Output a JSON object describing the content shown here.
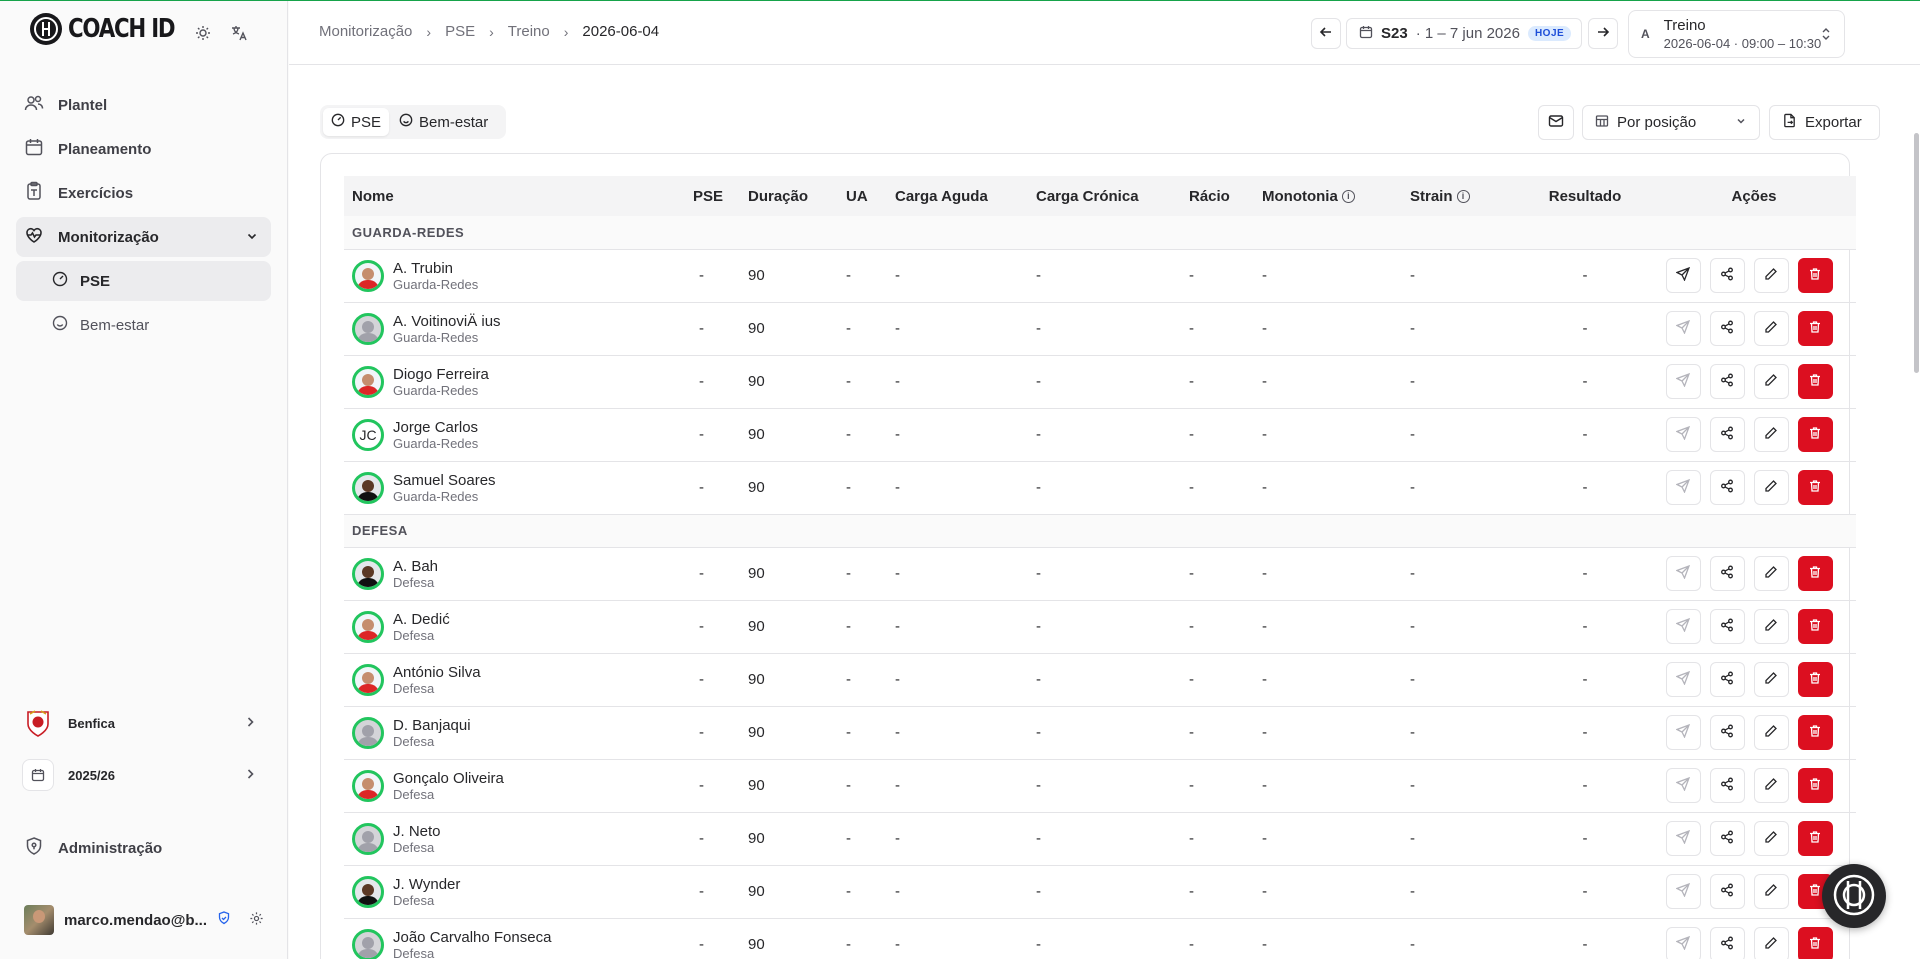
{
  "app": {
    "brand": "COACH ID"
  },
  "sidebar": {
    "items": [
      {
        "label": "Plantel"
      },
      {
        "label": "Planeamento"
      },
      {
        "label": "Exercícios"
      },
      {
        "label": "Monitorização"
      }
    ],
    "subitems": [
      {
        "label": "PSE"
      },
      {
        "label": "Bem-estar"
      }
    ],
    "club": "Benfica",
    "season": "2025/26",
    "admin": "Administração",
    "user_email": "marco.mendao@b..."
  },
  "topbar": {
    "breadcrumb": [
      "Monitorização",
      "PSE",
      "Treino",
      "2026-06-04"
    ],
    "week_code": "S23",
    "week_range": "· 1 – 7 jun 2026",
    "today_badge": "HOJE",
    "session_avatar": "A",
    "session_title": "Treino",
    "session_detail": "2026-06-04 · 09:00 – 10:30"
  },
  "toolbar": {
    "tabs": [
      {
        "label": "PSE"
      },
      {
        "label": "Bem-estar"
      }
    ],
    "group_select": "Por posição",
    "export_label": "Exportar"
  },
  "table": {
    "columns": [
      "Nome",
      "PSE",
      "Duração",
      "UA",
      "Carga Aguda",
      "Carga Crónica",
      "Rácio",
      "Monotonia",
      "Strain",
      "Resultado",
      "Ações"
    ],
    "groups": [
      {
        "name": "GUARDA-REDES",
        "players": [
          {
            "name": "A. Trubin",
            "position": "Guarda-Redes",
            "avatar": "photo",
            "initials": "",
            "send_enabled": true,
            "pse": "-",
            "duration": "90",
            "ua": "-",
            "acute": "-",
            "chronic": "-",
            "ratio": "-",
            "monotony": "-",
            "strain": "-",
            "result": "-"
          },
          {
            "name": "A. VoitinoviÄ ius",
            "position": "Guarda-Redes",
            "avatar": "grey",
            "initials": "",
            "send_enabled": false,
            "pse": "-",
            "duration": "90",
            "ua": "-",
            "acute": "-",
            "chronic": "-",
            "ratio": "-",
            "monotony": "-",
            "strain": "-",
            "result": "-"
          },
          {
            "name": "Diogo Ferreira",
            "position": "Guarda-Redes",
            "avatar": "photo",
            "initials": "",
            "send_enabled": false,
            "pse": "-",
            "duration": "90",
            "ua": "-",
            "acute": "-",
            "chronic": "-",
            "ratio": "-",
            "monotony": "-",
            "strain": "-",
            "result": "-"
          },
          {
            "name": "Jorge Carlos",
            "position": "Guarda-Redes",
            "avatar": "initials",
            "initials": "JC",
            "send_enabled": false,
            "pse": "-",
            "duration": "90",
            "ua": "-",
            "acute": "-",
            "chronic": "-",
            "ratio": "-",
            "monotony": "-",
            "strain": "-",
            "result": "-"
          },
          {
            "name": "Samuel Soares",
            "position": "Guarda-Redes",
            "avatar": "dark",
            "initials": "",
            "send_enabled": false,
            "pse": "-",
            "duration": "90",
            "ua": "-",
            "acute": "-",
            "chronic": "-",
            "ratio": "-",
            "monotony": "-",
            "strain": "-",
            "result": "-"
          }
        ]
      },
      {
        "name": "DEFESA",
        "players": [
          {
            "name": "A. Bah",
            "position": "Defesa",
            "avatar": "dark",
            "initials": "",
            "send_enabled": false,
            "pse": "-",
            "duration": "90",
            "ua": "-",
            "acute": "-",
            "chronic": "-",
            "ratio": "-",
            "monotony": "-",
            "strain": "-",
            "result": "-"
          },
          {
            "name": "A. Dedić",
            "position": "Defesa",
            "avatar": "photo",
            "initials": "",
            "send_enabled": false,
            "pse": "-",
            "duration": "90",
            "ua": "-",
            "acute": "-",
            "chronic": "-",
            "ratio": "-",
            "monotony": "-",
            "strain": "-",
            "result": "-"
          },
          {
            "name": "António Silva",
            "position": "Defesa",
            "avatar": "photo",
            "initials": "",
            "send_enabled": false,
            "pse": "-",
            "duration": "90",
            "ua": "-",
            "acute": "-",
            "chronic": "-",
            "ratio": "-",
            "monotony": "-",
            "strain": "-",
            "result": "-"
          },
          {
            "name": "D. Banjaqui",
            "position": "Defesa",
            "avatar": "grey",
            "initials": "",
            "send_enabled": false,
            "pse": "-",
            "duration": "90",
            "ua": "-",
            "acute": "-",
            "chronic": "-",
            "ratio": "-",
            "monotony": "-",
            "strain": "-",
            "result": "-"
          },
          {
            "name": "Gonçalo Oliveira",
            "position": "Defesa",
            "avatar": "photo",
            "initials": "",
            "send_enabled": false,
            "pse": "-",
            "duration": "90",
            "ua": "-",
            "acute": "-",
            "chronic": "-",
            "ratio": "-",
            "monotony": "-",
            "strain": "-",
            "result": "-"
          },
          {
            "name": "J. Neto",
            "position": "Defesa",
            "avatar": "grey",
            "initials": "",
            "send_enabled": false,
            "pse": "-",
            "duration": "90",
            "ua": "-",
            "acute": "-",
            "chronic": "-",
            "ratio": "-",
            "monotony": "-",
            "strain": "-",
            "result": "-"
          },
          {
            "name": "J. Wynder",
            "position": "Defesa",
            "avatar": "dark",
            "initials": "",
            "send_enabled": false,
            "pse": "-",
            "duration": "90",
            "ua": "-",
            "acute": "-",
            "chronic": "-",
            "ratio": "-",
            "monotony": "-",
            "strain": "-",
            "result": "-"
          },
          {
            "name": "João Carvalho Fonseca",
            "position": "Defesa",
            "avatar": "grey",
            "initials": "",
            "send_enabled": false,
            "pse": "-",
            "duration": "90",
            "ua": "-",
            "acute": "-",
            "chronic": "-",
            "ratio": "-",
            "monotony": "-",
            "strain": "-",
            "result": "-"
          }
        ]
      }
    ]
  },
  "colors": {
    "accent_green": "#22c55e",
    "danger": "#dc0f20",
    "badge_blue": "#dbeafe"
  },
  "icons": {
    "theme": "sun-icon",
    "language": "translate-icon",
    "plantel": "users-icon",
    "planeamento": "calendar-icon",
    "exercicios": "clipboard-icon",
    "monitorizacao": "heart-pulse-icon",
    "pse": "gauge-icon",
    "bem_estar": "smile-icon",
    "admin": "shield-icon",
    "row_actions": [
      "send-icon",
      "share-icon",
      "edit-icon",
      "trash-icon"
    ]
  }
}
